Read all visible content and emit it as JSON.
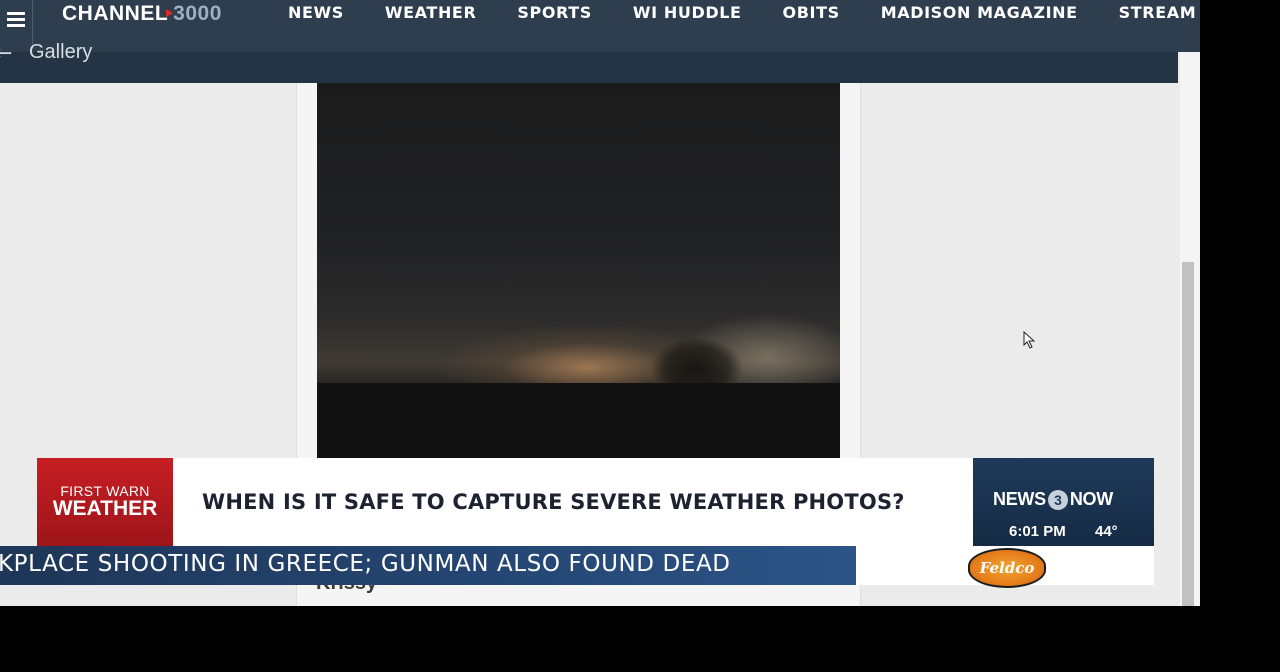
{
  "header": {
    "logo": {
      "text": "CHANNEL",
      "number": "3000"
    },
    "nav": [
      "NEWS",
      "WEATHER",
      "SPORTS",
      "WI HUDDLE",
      "OBITS",
      "MADISON MAGAZINE",
      "STREAM"
    ]
  },
  "gallery": {
    "back_label": "Gallery"
  },
  "photo": {
    "credit": "Krissy"
  },
  "broadcast": {
    "brand_line1": "FIRST WARN",
    "brand_line2": "WEATHER",
    "headline": "WHEN IS IT SAFE TO CAPTURE SEVERE WEATHER PHOTOS?",
    "station": {
      "prefix": "NEWS",
      "number": "3",
      "suffix": "NOW"
    },
    "time": "6:01 PM",
    "temperature": "44°",
    "ticker": "KPLACE SHOOTING IN GREECE; GUNMAN ALSO FOUND DEAD",
    "sponsor": "Feldco"
  }
}
